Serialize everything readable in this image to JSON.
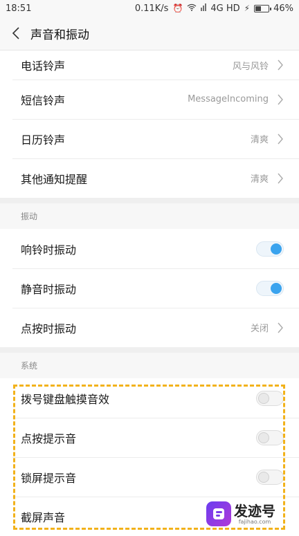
{
  "status_bar": {
    "time": "18:51",
    "network_speed": "0.11K/s",
    "network_type": "4G HD",
    "battery": "46%",
    "battery_level": 0.46,
    "icons": [
      "alarm-icon",
      "wifi-icon",
      "signal-icon",
      "charging-icon"
    ]
  },
  "header": {
    "title": "声音和振动",
    "back_icon": "chevron-left-icon"
  },
  "ringtones": [
    {
      "label": "电话铃声",
      "value": "风与风铃"
    },
    {
      "label": "短信铃声",
      "value": "MessageIncoming"
    },
    {
      "label": "日历铃声",
      "value": "清爽"
    },
    {
      "label": "其他通知提醒",
      "value": "清爽"
    }
  ],
  "vibration": {
    "header": "振动",
    "items": [
      {
        "label": "响铃时振动",
        "toggle": true
      },
      {
        "label": "静音时振动",
        "toggle": true
      },
      {
        "label": "点按时振动",
        "value": "关闭"
      }
    ]
  },
  "system": {
    "header": "系统",
    "items": [
      {
        "label": "拨号键盘触摸音效",
        "toggle": false
      },
      {
        "label": "点按提示音",
        "toggle": false
      },
      {
        "label": "锁屏提示音",
        "toggle": false
      },
      {
        "label": "截屏声音"
      }
    ]
  },
  "watermark": {
    "title": "发迹号",
    "url": "fajihao.com"
  },
  "colors": {
    "toggle_on": "#3aa3ee",
    "highlight": "#f2b21b"
  }
}
